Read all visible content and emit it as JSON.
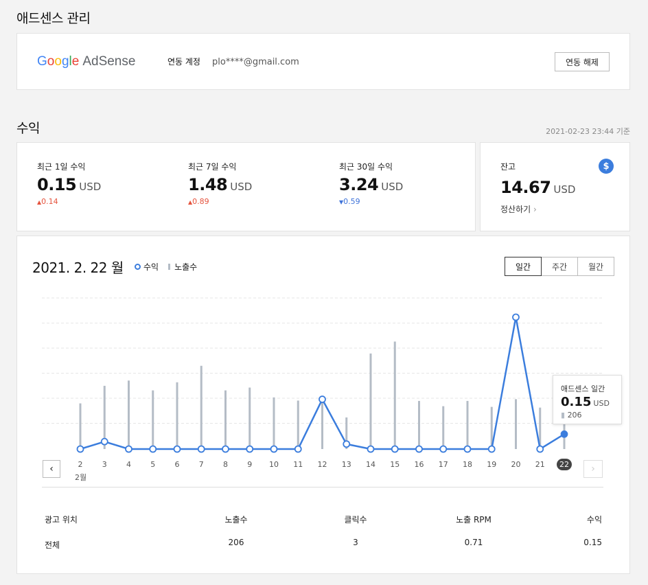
{
  "adsense_section": {
    "title": "애드센스 관리",
    "logo": {
      "google": "Google",
      "adsense": "AdSense"
    },
    "account_label": "연동 계정",
    "account_value": "plo****@gmail.com",
    "unlink_button": "연동 해제"
  },
  "revenue_section": {
    "title": "수익",
    "timestamp": "2021-02-23 23:44 기준"
  },
  "stats": [
    {
      "label": "최근 1일 수익",
      "value": "0.15",
      "unit": "USD",
      "delta": "0.14",
      "direction": "up"
    },
    {
      "label": "최근 7일 수익",
      "value": "1.48",
      "unit": "USD",
      "delta": "0.89",
      "direction": "up"
    },
    {
      "label": "최근 30일 수익",
      "value": "3.24",
      "unit": "USD",
      "delta": "0.59",
      "direction": "down"
    }
  ],
  "balance": {
    "label": "잔고",
    "value": "14.67",
    "unit": "USD",
    "settle_link": "정산하기",
    "icon": "dollar-icon"
  },
  "chart_header": {
    "date": "2021. 2. 22 월",
    "legend_revenue": "수익",
    "legend_impressions": "노출수",
    "periods": [
      "일간",
      "주간",
      "월간"
    ],
    "active_period": "일간"
  },
  "tooltip": {
    "title": "애드센스 일간",
    "value": "0.15",
    "unit": "USD",
    "impressions": "206"
  },
  "month_label": "2월",
  "chart_data": {
    "type": "line",
    "categories": [
      "2",
      "3",
      "4",
      "5",
      "6",
      "7",
      "8",
      "9",
      "10",
      "11",
      "12",
      "13",
      "14",
      "15",
      "16",
      "17",
      "18",
      "19",
      "20",
      "21",
      "22"
    ],
    "series": [
      {
        "name": "수익",
        "values": [
          0.0,
          0.03,
          0.0,
          0.0,
          0.0,
          0.0,
          0.0,
          0.0,
          0.0,
          0.0,
          0.2,
          0.02,
          0.0,
          0.0,
          0.0,
          0.0,
          0.0,
          0.0,
          0.53,
          0.0,
          0.06
        ]
      },
      {
        "name": "노출수",
        "values": [
          130,
          180,
          195,
          167,
          190,
          237,
          167,
          175,
          147,
          138,
          140,
          90,
          272,
          306,
          137,
          122,
          137,
          120,
          142,
          118,
          80
        ]
      }
    ],
    "selected_index": 20,
    "grid": true
  },
  "table": {
    "headers": [
      "광고 위치",
      "노출수",
      "클릭수",
      "노출 RPM",
      "수익"
    ],
    "rows": [
      [
        "전체",
        "206",
        "3",
        "0.71",
        "0.15"
      ]
    ]
  },
  "colors": {
    "accent": "#3b7ddd",
    "bar": "#b4bcc6",
    "up": "#e5533d",
    "down": "#3f73d9"
  }
}
